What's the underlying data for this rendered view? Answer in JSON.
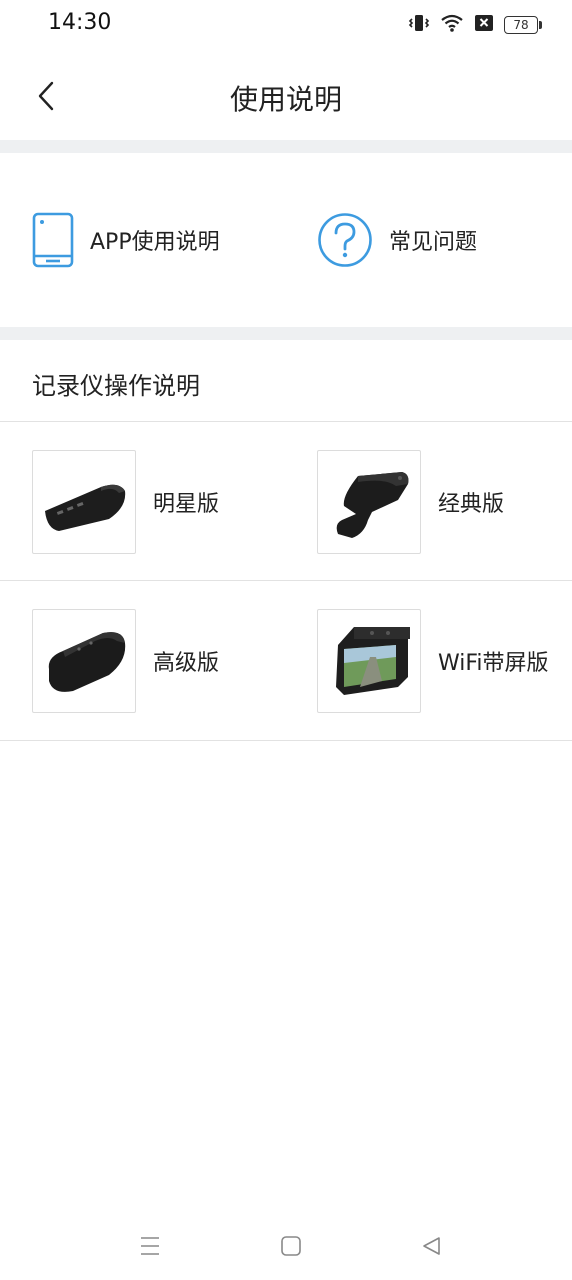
{
  "status_bar": {
    "time": "14:30",
    "battery": "78"
  },
  "header": {
    "title": "使用说明"
  },
  "help": {
    "app_manual": "APP使用说明",
    "faq": "常见问题"
  },
  "section": {
    "title": "记录仪操作说明"
  },
  "devices": [
    {
      "label": "明星版",
      "image": "dashcam-star"
    },
    {
      "label": "经典版",
      "image": "dashcam-classic"
    },
    {
      "label": "高级版",
      "image": "dashcam-advanced"
    },
    {
      "label": "WiFi带屏版",
      "image": "dashcam-wifi-screen"
    }
  ],
  "colors": {
    "accent": "#3d9be0",
    "band": "#eef0f2",
    "divider": "#e2e2e2"
  }
}
